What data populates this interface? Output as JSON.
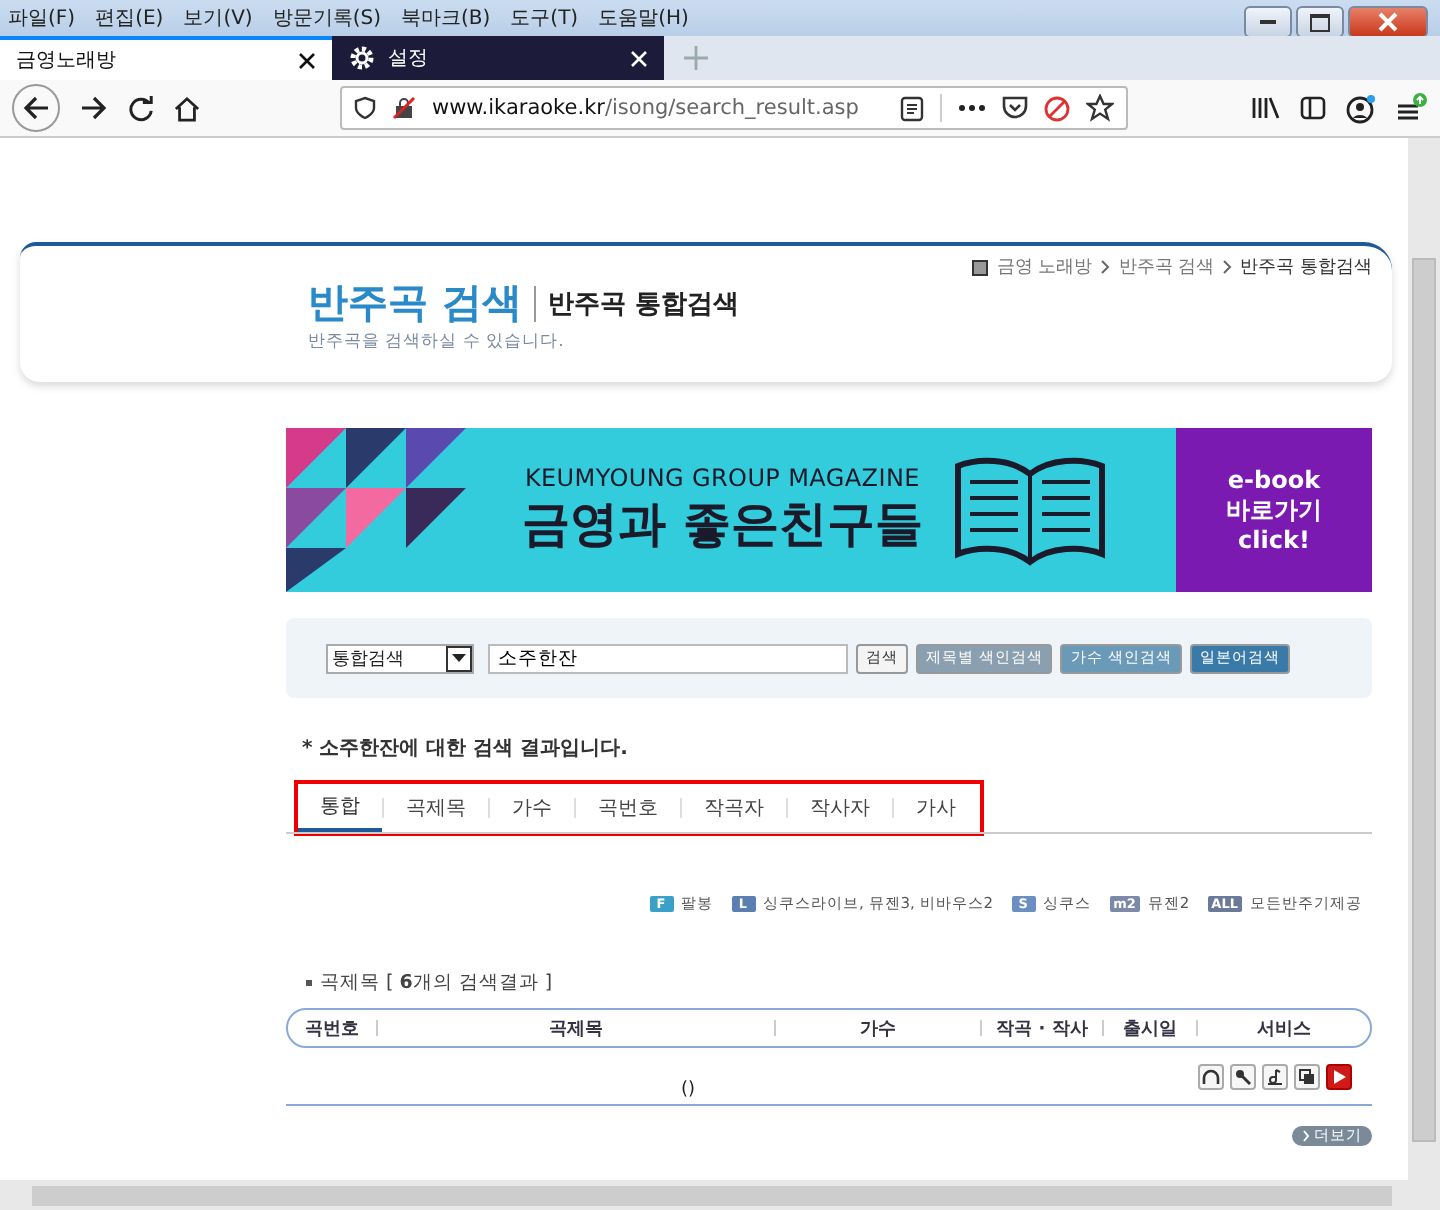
{
  "menu": [
    "파일(F)",
    "편집(E)",
    "보기(V)",
    "방문기록(S)",
    "북마크(B)",
    "도구(T)",
    "도움말(H)"
  ],
  "browser_tabs": [
    {
      "title": "금영노래방",
      "selected": true,
      "kind": "page"
    },
    {
      "title": "설정",
      "selected": false,
      "kind": "settings"
    }
  ],
  "address": {
    "host": "www.ikaraoke.kr",
    "path": "/isong/search_result.asp"
  },
  "breadcrumb": [
    "금영 노래방",
    "반주곡 검색",
    "반주곡 통합검색"
  ],
  "header": {
    "title": "반주곡 검색",
    "subtitle": "반주곡 통합검색",
    "description": "반주곡을 검색하실 수 있습니다."
  },
  "banner": {
    "kicker": "KEUMYOUNG GROUP MAGAZINE",
    "headline": "금영과 좋은친구들",
    "cta": [
      "e-book",
      "바로가기",
      "click!"
    ]
  },
  "search": {
    "scope": "통합검색",
    "value": "소주한잔",
    "buttons": [
      {
        "label": "검색",
        "kind": "plain"
      },
      {
        "label": "제목별 색인검색",
        "kind": "grey"
      },
      {
        "label": "가수 색인검색",
        "kind": "light"
      },
      {
        "label": "일본어검색",
        "kind": "dark"
      }
    ]
  },
  "result_message": "* **소주한잔**에 대한 검색 결과입니다.",
  "result_tabs_highlighted": true,
  "result_tabs": [
    {
      "label": "통합",
      "selected": true
    },
    {
      "label": "곡제목",
      "selected": false
    },
    {
      "label": "가수",
      "selected": false
    },
    {
      "label": "곡번호",
      "selected": false
    },
    {
      "label": "작곡자",
      "selected": false
    },
    {
      "label": "작사자",
      "selected": false
    },
    {
      "label": "가사",
      "selected": false
    }
  ],
  "legend": [
    {
      "badge": "F",
      "label": "팔봉",
      "color": "#3aa0c8"
    },
    {
      "badge": "L",
      "label": "싱쿠스라이브, 뮤젠3, 비바우스2",
      "color": "#5a7fb0"
    },
    {
      "badge": "S",
      "label": "싱쿠스",
      "color": "#6a8fc0"
    },
    {
      "badge": "m2",
      "label": "뮤젠2",
      "color": "#7a8aa8"
    },
    {
      "badge": "ALL",
      "label": "모든반주기제공",
      "color": "#6a7a98"
    }
  ],
  "section": {
    "title": "곡제목 [ **6**개의 검색결과 ]"
  },
  "table": {
    "columns": [
      "곡번호",
      "곡제목",
      "가수",
      "작곡 · 작사",
      "출시일",
      "서비스"
    ],
    "rows": [
      {
        "title": "()"
      }
    ]
  },
  "more_button": "더보기"
}
